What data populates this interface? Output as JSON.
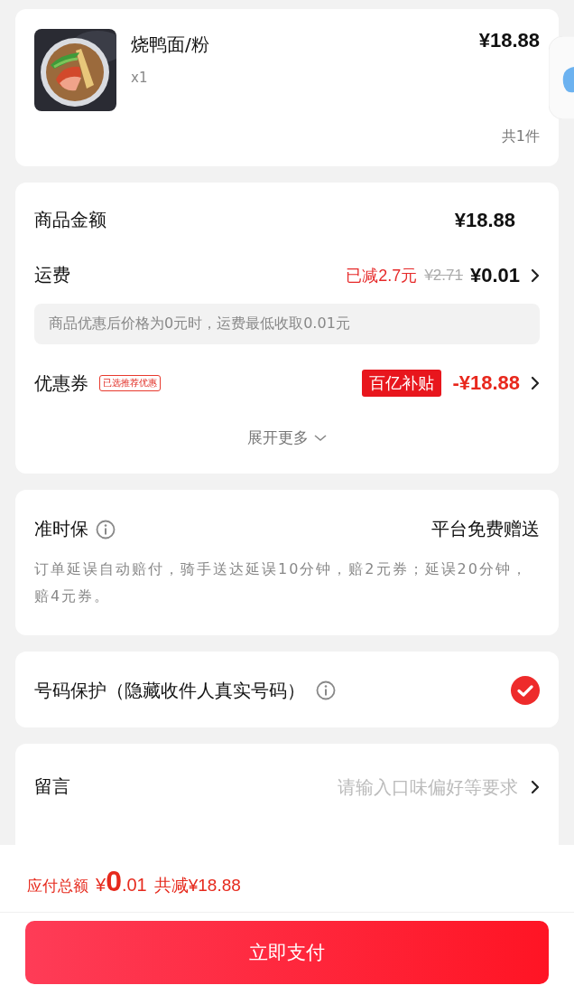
{
  "product": {
    "name": "烧鸭面/粉",
    "quantity": "x1",
    "price": "¥18.88",
    "count": "共1件"
  },
  "subtotal": {
    "label": "商品金额",
    "value": "¥18.88"
  },
  "delivery_fee": {
    "label": "运费",
    "discount": "已减2.7元",
    "original_price": "¥2.71",
    "value": "¥0.01"
  },
  "fee_note": "商品优惠后价格为0元时，运费最低收取0.01元",
  "coupon": {
    "label": "优惠券",
    "tag": "已选推荐优惠",
    "badge": "百亿补贴",
    "value": "-¥18.88"
  },
  "expand": {
    "label": "展开更多",
    "expanded": false
  },
  "on_time": {
    "title": "准时保",
    "value": "平台免费赠送",
    "description": "订单延误自动赔付，骑手送达延误10分钟，赔2元券；延误20分钟，赔4元券。"
  },
  "number_protection": {
    "label": "号码保护（隐藏收件人真实号码）",
    "checked": true
  },
  "message": {
    "label": "留言",
    "placeholder": "请输入口味偏好等要求"
  },
  "footer": {
    "total_label": "应付总额",
    "currency": "¥",
    "total_integer": "0",
    "total_decimal": ".01",
    "saved": "共减¥18.88",
    "pay_button": "立即支付"
  }
}
